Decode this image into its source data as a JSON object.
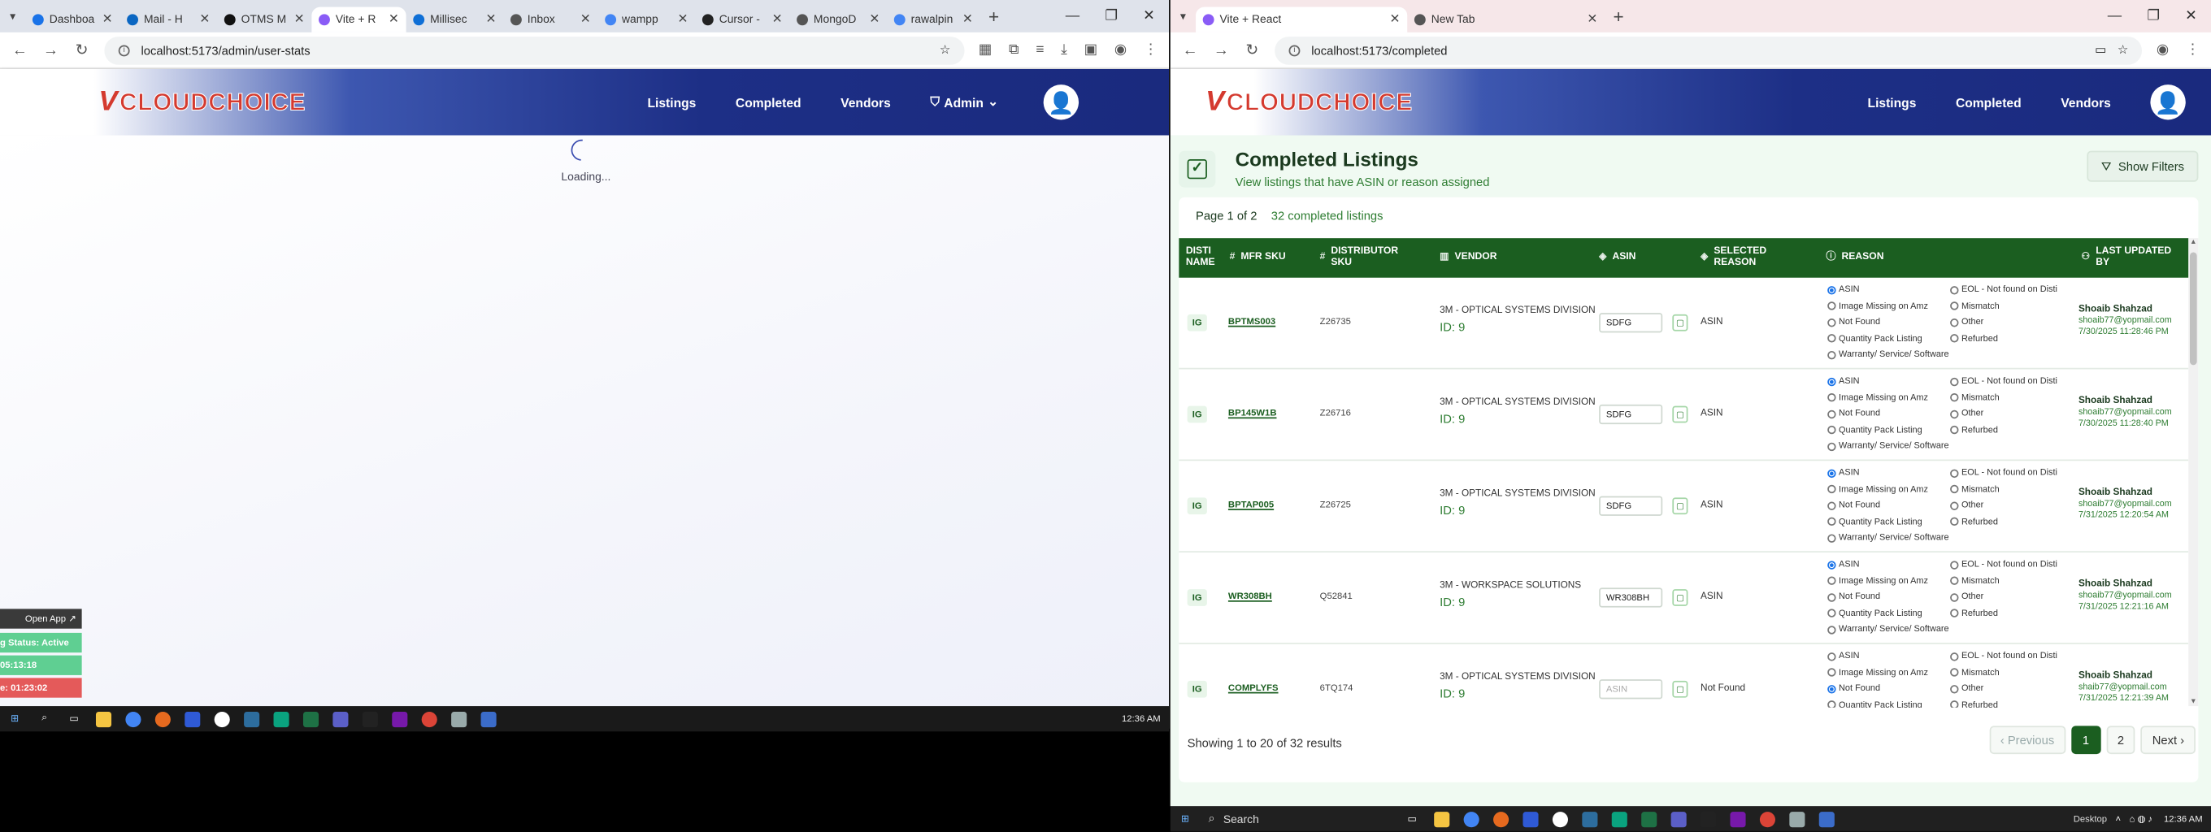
{
  "left": {
    "tabs": [
      {
        "label": "Dashboa",
        "color": "#1a73e8",
        "active": false
      },
      {
        "label": "Mail - H",
        "color": "#0a66c2",
        "active": false
      },
      {
        "label": "OTMS M",
        "color": "#111111",
        "active": false
      },
      {
        "label": "Vite + R",
        "color": "#8a5cf6",
        "active": true
      },
      {
        "label": "Millisec",
        "color": "#0f6fd6",
        "active": false
      },
      {
        "label": "Inbox",
        "color": "#555555",
        "active": false
      },
      {
        "label": "wampp",
        "color": "#4285f4",
        "active": false
      },
      {
        "label": "Cursor -",
        "color": "#222222",
        "active": false
      },
      {
        "label": "MongoD",
        "color": "#555555",
        "active": false
      },
      {
        "label": "rawalpin",
        "color": "#4285f4",
        "active": false
      }
    ],
    "url": "localhost:5173/admin/user-stats",
    "nav": {
      "listings": "Listings",
      "completed": "Completed",
      "vendors": "Vendors",
      "admin": "Admin"
    },
    "loading": "Loading...",
    "widget": {
      "open_app": "Open App ↗",
      "status": "g Status: Active",
      "time1": "05:13:18",
      "time2": "e: 01:23:02"
    },
    "taskbar_time": "12:36 AM"
  },
  "right": {
    "tabs": [
      {
        "label": "Vite + React",
        "color": "#8a5cf6",
        "active": true
      },
      {
        "label": "New Tab",
        "color": "#555555",
        "active": false
      }
    ],
    "url": "localhost:5173/completed",
    "brand": {
      "v": "V",
      "text": "CLOUDCHOICE"
    },
    "nav": {
      "listings": "Listings",
      "completed": "Completed",
      "vendors": "Vendors"
    },
    "page": {
      "title": "Completed Listings",
      "subtitle": "View listings that have ASIN or reason assigned",
      "filters": "Show Filters",
      "page_of": "Page 1 of 2",
      "count": "32 completed listings"
    },
    "headers": {
      "disti": "DISTI NAME",
      "mfr": "MFR SKU",
      "dsku": "DISTRIBUTOR SKU",
      "vendor": "VENDOR",
      "asin": "ASIN",
      "selected": "SELECTED REASON",
      "reason": "REASON",
      "updated": "LAST UPDATED BY"
    },
    "reason_options": [
      "ASIN",
      "Image Missing on Amz",
      "Not Found",
      "Quantity Pack Listing",
      "Warranty/ Service/ Software",
      "EOL - Not found on Disti",
      "Mismatch",
      "Other",
      "Refurbed"
    ],
    "rows": [
      {
        "disti": "IG",
        "mfr": "BPTMS003",
        "dsku": "Z26735",
        "vendor": "3M - OPTICAL SYSTEMS DIVISION",
        "vendor_id": "ID: 9",
        "asin": "SDFG",
        "asin_placeholder": "ASIN",
        "selected": "ASIN",
        "checked": 0,
        "user": "Shoaib Shahzad",
        "email": "shoaib77@yopmail.com",
        "date": "7/30/2025 11:28:46 PM"
      },
      {
        "disti": "IG",
        "mfr": "BP145W1B",
        "dsku": "Z26716",
        "vendor": "3M - OPTICAL SYSTEMS DIVISION",
        "vendor_id": "ID: 9",
        "asin": "SDFG",
        "asin_placeholder": "ASIN",
        "selected": "ASIN",
        "checked": 0,
        "user": "Shoaib Shahzad",
        "email": "shoaib77@yopmail.com",
        "date": "7/30/2025 11:28:40 PM"
      },
      {
        "disti": "IG",
        "mfr": "BPTAP005",
        "dsku": "Z26725",
        "vendor": "3M - OPTICAL SYSTEMS DIVISION",
        "vendor_id": "ID: 9",
        "asin": "SDFG",
        "asin_placeholder": "ASIN",
        "selected": "ASIN",
        "checked": 0,
        "user": "Shoaib Shahzad",
        "email": "shoaib77@yopmail.com",
        "date": "7/31/2025 12:20:54 AM"
      },
      {
        "disti": "IG",
        "mfr": "WR308BH",
        "dsku": "Q52841",
        "vendor": "3M - WORKSPACE SOLUTIONS",
        "vendor_id": "ID: 9",
        "asin": "WR308BH",
        "asin_placeholder": "ASIN",
        "selected": "ASIN",
        "checked": 0,
        "user": "Shoaib Shahzad",
        "email": "shoaib77@yopmail.com",
        "date": "7/31/2025 12:21:16 AM"
      },
      {
        "disti": "IG",
        "mfr": "COMPLYFS",
        "dsku": "6TQ174",
        "vendor": "3M - OPTICAL SYSTEMS DIVISION",
        "vendor_id": "ID: 9",
        "asin": "",
        "asin_placeholder": "ASIN",
        "selected": "Not Found",
        "checked": 2,
        "user": "Shoaib Shahzad",
        "email": "shaib77@yopmail.com",
        "date": "7/31/2025 12:21:39 AM"
      }
    ],
    "showing": "Showing 1 to 20 of 32 results",
    "pager": {
      "prev": "‹ Previous",
      "p1": "1",
      "p2": "2",
      "next": "Next ›"
    },
    "taskbar": {
      "search": "Search",
      "desktop": "Desktop",
      "time": "12:36 AM"
    }
  },
  "colors": {
    "header_blue": "#1d2f86",
    "table_green": "#1b5e20",
    "accent_green": "#2e7d32",
    "brand_red": "#d43a2f"
  }
}
